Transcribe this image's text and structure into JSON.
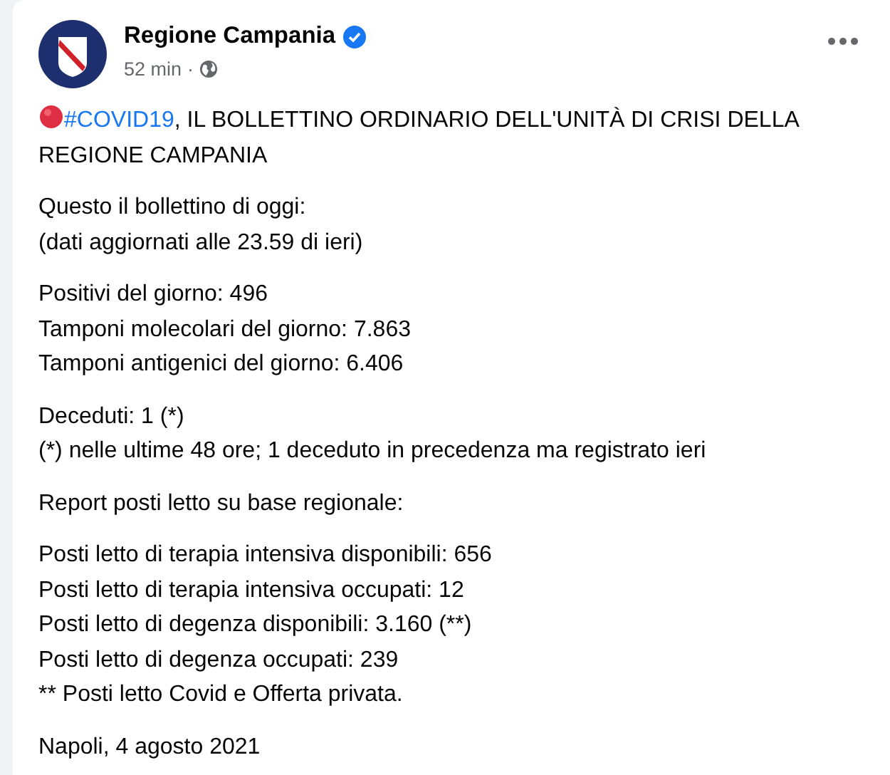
{
  "post": {
    "author": "Regione Campania",
    "verified": true,
    "time": "52 min",
    "separator": "·",
    "headline": {
      "hashtag": "#COVID19",
      "text": ", IL BOLLETTINO ORDINARIO DELL'UNITÀ DI CRISI DELLA REGIONE CAMPANIA"
    },
    "paragraphs": [
      [
        "Questo il bollettino di oggi:",
        "(dati aggiornati alle 23.59 di ieri)"
      ],
      [
        "Positivi del giorno: 496",
        "Tamponi molecolari del giorno: 7.863",
        "Tamponi antigenici del giorno: 6.406"
      ],
      [
        "Deceduti: 1 (*)",
        "(*) nelle ultime 48 ore; 1 deceduto in precedenza ma registrato ieri"
      ],
      [
        "Report posti letto su base regionale:"
      ],
      [
        "Posti letto di terapia intensiva disponibili: 656",
        "Posti letto di terapia intensiva occupati: 12",
        "Posti letto di degenza disponibili: 3.160 (**)",
        "Posti letto di degenza occupati: 239",
        "** Posti letto Covid e Offerta privata."
      ],
      [
        "Napoli, 4 agosto 2021"
      ]
    ]
  }
}
